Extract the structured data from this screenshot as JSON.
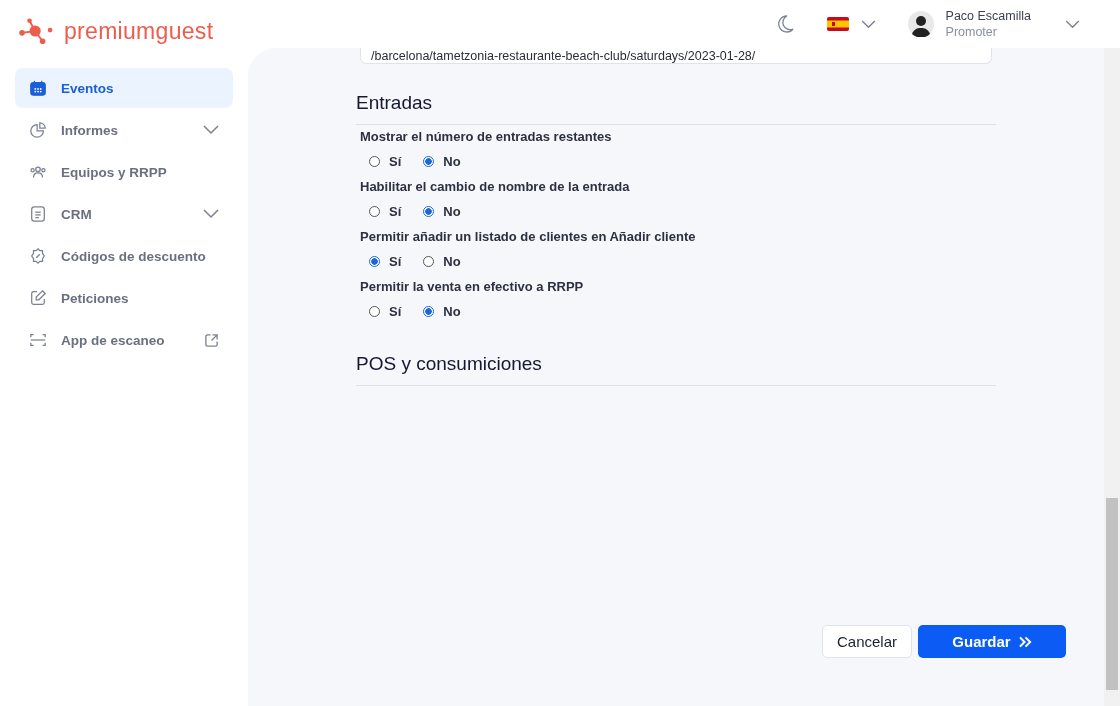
{
  "brand": "premiumguest",
  "sidebar": {
    "items": [
      {
        "label": "Eventos",
        "selected": true,
        "expandable": false,
        "external": false
      },
      {
        "label": "Informes",
        "selected": false,
        "expandable": true,
        "external": false
      },
      {
        "label": "Equipos y RRPP",
        "selected": false,
        "expandable": false,
        "external": false
      },
      {
        "label": "CRM",
        "selected": false,
        "expandable": true,
        "external": false
      },
      {
        "label": "Códigos de descuento",
        "selected": false,
        "expandable": false,
        "external": false
      },
      {
        "label": "Peticiones",
        "selected": false,
        "expandable": false,
        "external": false
      },
      {
        "label": "App de escaneo",
        "selected": false,
        "expandable": false,
        "external": true
      }
    ]
  },
  "user": {
    "name": "Paco Escamilla",
    "role": "Promoter"
  },
  "url_field": {
    "value": "/barcelona/tametzonia-restaurante-beach-club/saturdays/2023-01-28/"
  },
  "sections": [
    {
      "title": "Entradas",
      "questions": [
        {
          "label": "Mostrar el número de entradas restantes",
          "options": [
            {
              "label": "Sí",
              "selected": false
            },
            {
              "label": "No",
              "selected": true
            }
          ]
        },
        {
          "label": "Habilitar el cambio de nombre de la entrada",
          "options": [
            {
              "label": "Sí",
              "selected": false
            },
            {
              "label": "No",
              "selected": true
            }
          ]
        },
        {
          "label": "Permitir añadir un listado de clientes en Añadir cliente",
          "options": [
            {
              "label": "Sí",
              "selected": true
            },
            {
              "label": "No",
              "selected": false
            }
          ]
        },
        {
          "label": "Permitir la venta en efectivo a RRPP",
          "options": [
            {
              "label": "Sí",
              "selected": false
            },
            {
              "label": "No",
              "selected": true
            }
          ]
        }
      ]
    },
    {
      "title": "POS y consumiciones"
    }
  ],
  "buttons": {
    "cancel": "Cancelar",
    "save": "Guardar"
  }
}
